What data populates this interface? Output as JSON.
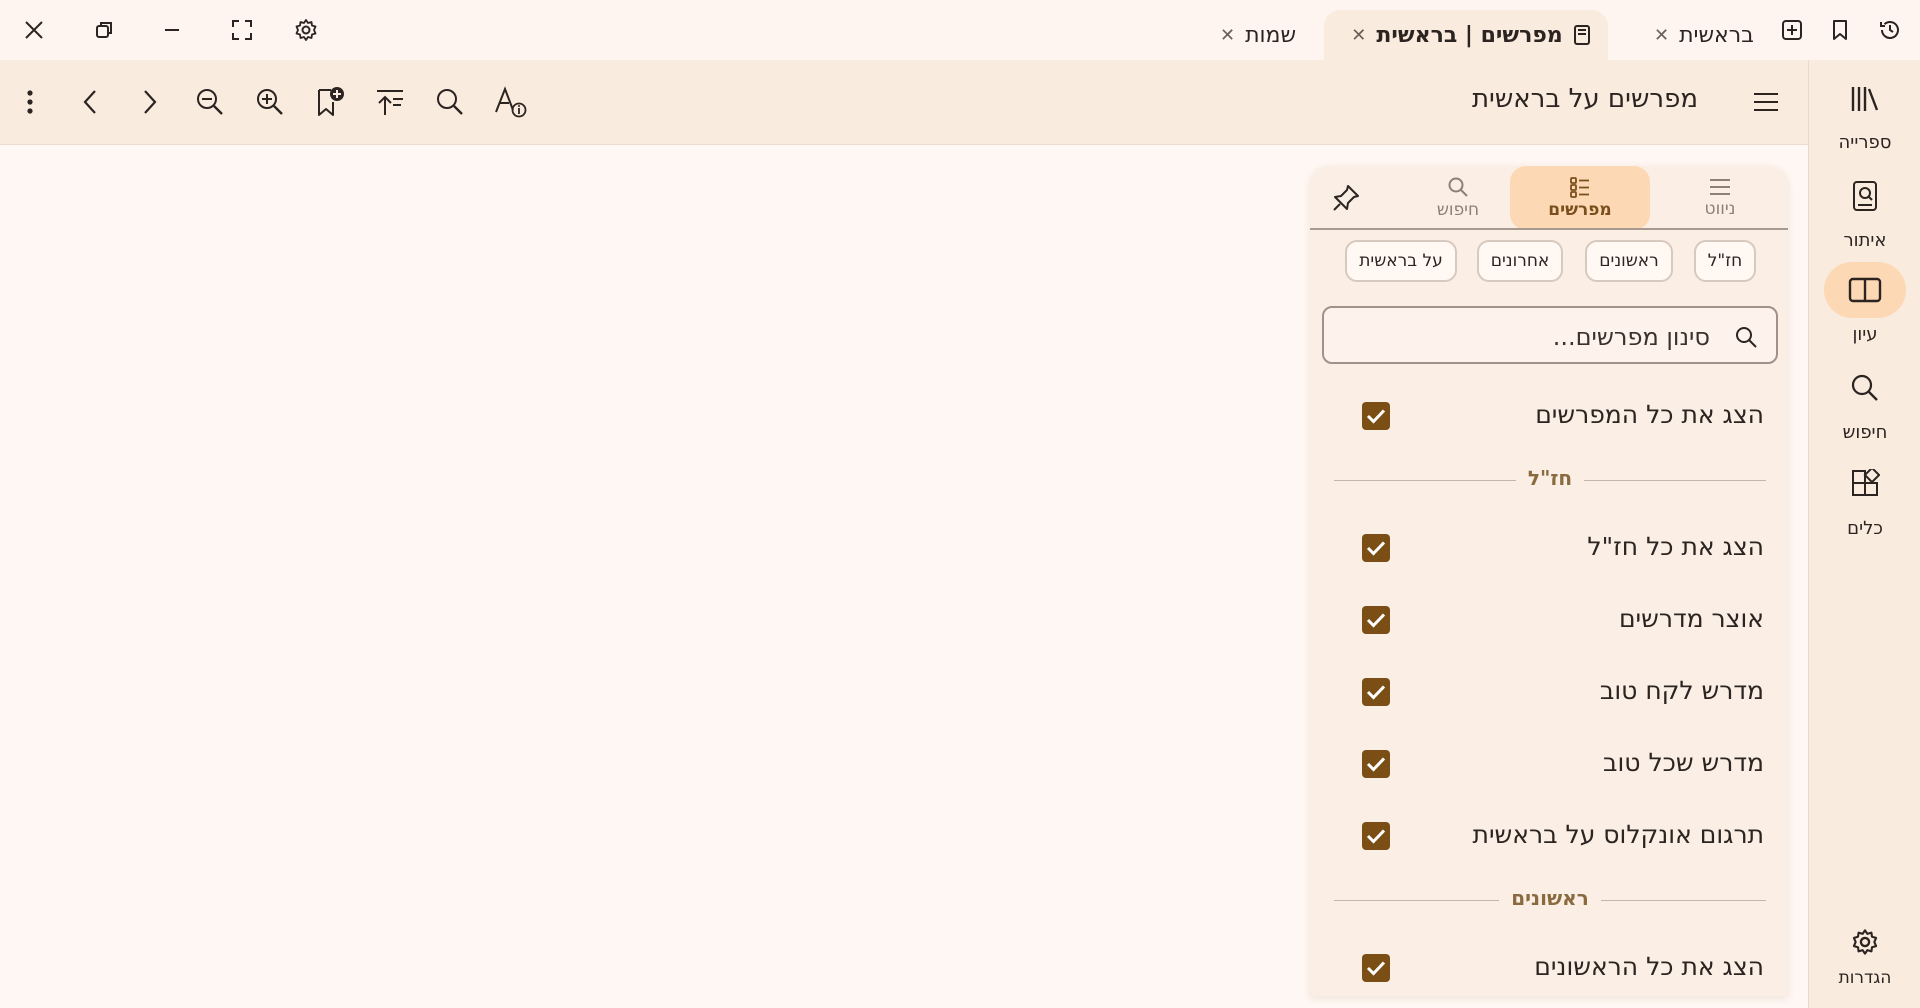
{
  "window": {
    "tabs": [
      {
        "label": "בראשית",
        "active": false
      },
      {
        "label": "מפרשים | בראשית",
        "active": true
      },
      {
        "label": "שמות",
        "active": false
      }
    ]
  },
  "toolbar": {
    "book_title": "מפרשים על בראשית"
  },
  "rail": {
    "items": [
      {
        "label": "ספרייה",
        "icon": "library-icon"
      },
      {
        "label": "איתור",
        "icon": "locate-book-icon"
      },
      {
        "label": "עיון",
        "icon": "open-book-icon",
        "active": true
      },
      {
        "label": "חיפוש",
        "icon": "search-icon"
      },
      {
        "label": "כלים",
        "icon": "tools-icon"
      }
    ],
    "settings_label": "הגדרות"
  },
  "panel": {
    "tabs": [
      {
        "label": "ניווט",
        "icon": "menu-icon"
      },
      {
        "label": "מפרשים",
        "icon": "list-icon",
        "active": true
      },
      {
        "label": "חיפוש",
        "icon": "search-icon"
      }
    ],
    "chips": [
      "חז\"ל",
      "ראשונים",
      "אחרונים",
      "על בראשית"
    ],
    "filter_placeholder": "סינון מפרשים...",
    "show_all": "הצג את כל המפרשים",
    "sections": [
      {
        "title": "חז\"ל",
        "show_all": "הצג את כל חז\"ל",
        "items": [
          "אוצר מדרשים",
          "מדרש לקח טוב",
          "מדרש שכל טוב",
          "תרגום אונקלוס על בראשית"
        ]
      },
      {
        "title": "ראשונים",
        "show_all": "הצג את כל הראשונים",
        "items": []
      }
    ]
  },
  "colors": {
    "accent": "#7b4e15",
    "active_tab": "#fcd8b5",
    "background": "#fff7f3",
    "toolbar": "#faebdf"
  }
}
